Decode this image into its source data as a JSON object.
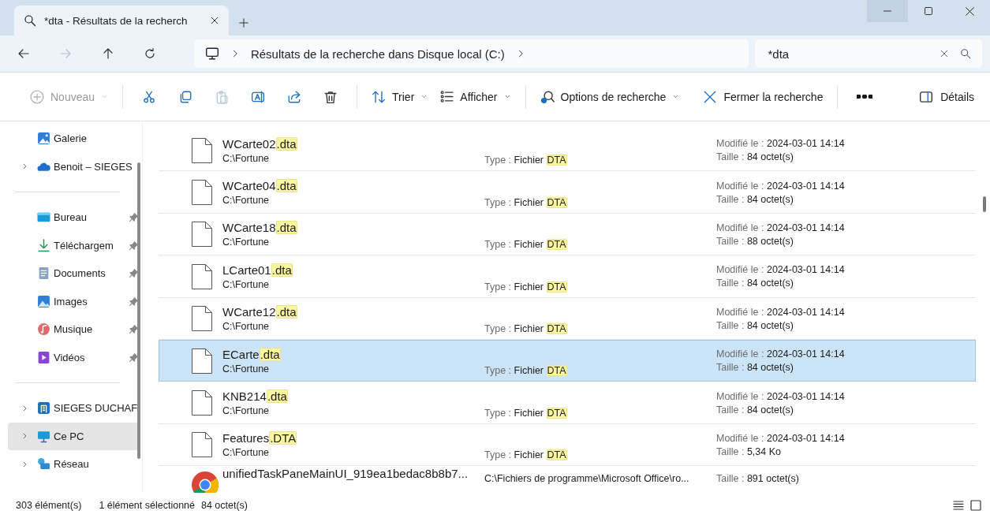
{
  "tabs": [
    {
      "title": "*dta - Résultats de la recherch",
      "selected": true
    }
  ],
  "address": {
    "path": "Résultats de la recherche dans Disque local (C:)"
  },
  "search": {
    "value": "*dta"
  },
  "toolbar": {
    "new": {
      "label": "Nouveau",
      "disabled": true
    },
    "actions": [
      {
        "disabled": false
      },
      {
        "disabled": false
      },
      {
        "disabled": true
      },
      {
        "disabled": false
      },
      {
        "disabled": false
      },
      {
        "disabled": false
      }
    ],
    "sort": {
      "label": "Trier"
    },
    "view": {
      "label": "Afficher"
    },
    "search_options": {
      "label": "Options de recherche"
    },
    "close_search": {
      "label": "Fermer la recherche"
    },
    "details": {
      "label": "Détails"
    }
  },
  "sidebar": {
    "groups": [
      [
        {
          "label": "Galerie",
          "expandable": false,
          "pinned": false,
          "selected": false
        },
        {
          "label": "Benoit – SIEGES",
          "expandable": true,
          "pinned": false,
          "selected": false
        }
      ],
      [
        {
          "label": "Bureau",
          "expandable": false,
          "pinned": true,
          "selected": false
        },
        {
          "label": "Téléchargem",
          "expandable": false,
          "pinned": true,
          "selected": false
        },
        {
          "label": "Documents",
          "expandable": false,
          "pinned": true,
          "selected": false
        },
        {
          "label": "Images",
          "expandable": false,
          "pinned": true,
          "selected": false
        },
        {
          "label": "Musique",
          "expandable": false,
          "pinned": true,
          "selected": false
        },
        {
          "label": "Vidéos",
          "expandable": false,
          "pinned": true,
          "selected": false
        }
      ],
      [
        {
          "label": "SIEGES DUCHAF",
          "expandable": true,
          "pinned": false,
          "selected": false
        },
        {
          "label": "Ce PC",
          "expandable": true,
          "pinned": false,
          "selected": true
        },
        {
          "label": "Réseau",
          "expandable": true,
          "pinned": false,
          "selected": false
        }
      ]
    ]
  },
  "files": [
    {
      "kind": "file",
      "name": "WCarte02",
      "match": ".dta",
      "path": "C:\\Fortune",
      "type_label": "Type :",
      "type_value": "Fichier",
      "type_match": "DTA",
      "modified_label": "Modifié le :",
      "modified": "2024-03-01 14:14",
      "size_label": "Taille :",
      "size": "84 octet(s)",
      "selected": false
    },
    {
      "kind": "file",
      "name": "WCarte04",
      "match": ".dta",
      "path": "C:\\Fortune",
      "type_label": "Type :",
      "type_value": "Fichier",
      "type_match": "DTA",
      "modified_label": "Modifié le :",
      "modified": "2024-03-01 14:14",
      "size_label": "Taille :",
      "size": "84 octet(s)",
      "selected": false
    },
    {
      "kind": "file",
      "name": "WCarte18",
      "match": ".dta",
      "path": "C:\\Fortune",
      "type_label": "Type :",
      "type_value": "Fichier",
      "type_match": "DTA",
      "modified_label": "Modifié le :",
      "modified": "2024-03-01 14:14",
      "size_label": "Taille :",
      "size": "88 octet(s)",
      "selected": false
    },
    {
      "kind": "file",
      "name": "LCarte01",
      "match": ".dta",
      "path": "C:\\Fortune",
      "type_label": "Type :",
      "type_value": "Fichier",
      "type_match": "DTA",
      "modified_label": "Modifié le :",
      "modified": "2024-03-01 14:14",
      "size_label": "Taille :",
      "size": "84 octet(s)",
      "selected": false
    },
    {
      "kind": "file",
      "name": "WCarte12",
      "match": ".dta",
      "path": "C:\\Fortune",
      "type_label": "Type :",
      "type_value": "Fichier",
      "type_match": "DTA",
      "modified_label": "Modifié le :",
      "modified": "2024-03-01 14:14",
      "size_label": "Taille :",
      "size": "84 octet(s)",
      "selected": false
    },
    {
      "kind": "file",
      "name": "ECarte",
      "match": ".dta",
      "path": "C:\\Fortune",
      "type_label": "Type :",
      "type_value": "Fichier",
      "type_match": "DTA",
      "modified_label": "Modifié le :",
      "modified": "2024-03-01 14:14",
      "size_label": "Taille :",
      "size": "84 octet(s)",
      "selected": true
    },
    {
      "kind": "file",
      "name": "KNB214",
      "match": ".dta",
      "path": "C:\\Fortune",
      "type_label": "Type :",
      "type_value": "Fichier",
      "type_match": "DTA",
      "modified_label": "Modifié le :",
      "modified": "2024-03-01 14:14",
      "size_label": "Taille :",
      "size": "84 octet(s)",
      "selected": false
    },
    {
      "kind": "file",
      "name": "Features",
      "match": ".DTA",
      "path": "C:\\Fortune",
      "type_label": "Type :",
      "type_value": "Fichier",
      "type_match": "DTA",
      "modified_label": "Modifié le :",
      "modified": "2024-03-01 14:14",
      "size_label": "Taille :",
      "size": "5,34 Ko",
      "selected": false
    },
    {
      "kind": "app",
      "name": "unifiedTaskPaneMainUI_919ea1bedac8b8b7...",
      "path": "C:\\Fichiers de programme\\Microsoft Office\\ro...",
      "size_label": "Taille :",
      "size": "891 octet(s)",
      "selected": false
    }
  ],
  "status_bar": {
    "count": "303 élément(s)",
    "selection": "1 élément sélectionné",
    "selection_size": "84 octet(s)"
  }
}
